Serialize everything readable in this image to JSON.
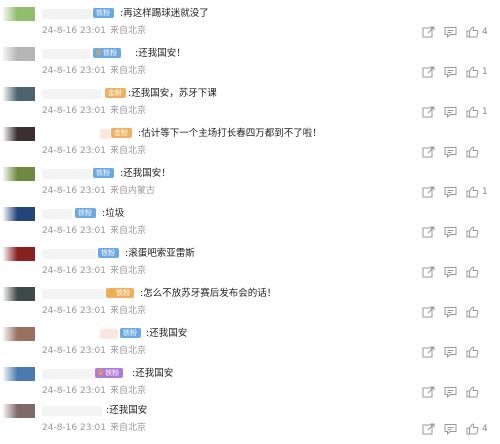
{
  "comments": [
    {
      "text": ":再这样踢球迷就没了",
      "badge": "铁粉",
      "badge_color": "#6aa8e8",
      "crown": false,
      "time": "24-8-16 23:01",
      "location": "来自北京",
      "likes": "4",
      "avatar_color": "#8fbf6a"
    },
    {
      "text": ":还我国安！",
      "badge": "铁粉",
      "badge_color": "#6aa8e8",
      "crown": true,
      "time": "24-8-16 23:01",
      "location": "来自北京",
      "likes": "1",
      "avatar_color": "#b5b5b5"
    },
    {
      "text": ":还我国安，苏牙下课",
      "badge": "金粉",
      "badge_color": "#f0b060",
      "crown": false,
      "time": "24-8-16 23:01",
      "location": "来自北京",
      "likes": "1",
      "avatar_color": "#4d6470"
    },
    {
      "text": ":估计等下一个主场打长春四万都到不了啦！",
      "badge": "金粉",
      "badge_color": "#f0b060",
      "crown": false,
      "time": "24-8-16 23:01",
      "location": "来自北京",
      "likes": "",
      "avatar_color": "#3a3030"
    },
    {
      "text": ":还我国安！",
      "badge": "铁粉",
      "badge_color": "#6aa8e8",
      "crown": false,
      "time": "24-8-16 23:01",
      "location": "来自内蒙古",
      "likes": "1",
      "avatar_color": "#6e8a40"
    },
    {
      "text": ":垃圾",
      "badge": "铁粉",
      "badge_color": "#6aa8e8",
      "crown": false,
      "time": "24-8-16 23:01",
      "location": "来自北京",
      "likes": "",
      "avatar_color": "#23457a"
    },
    {
      "text": ":滚蛋吧索亚雷斯",
      "badge": "铁粉",
      "badge_color": "#6aa8e8",
      "crown": false,
      "time": "24-8-16 23:01",
      "location": "来自北京",
      "likes": "",
      "avatar_color": "#8a2020"
    },
    {
      "text": ":怎么不放苏牙赛后发布会的话！",
      "badge": "铁粉",
      "badge_color": "#f0b060",
      "crown": true,
      "time": "24-8-16 23:01",
      "location": "来自北京",
      "likes": "",
      "avatar_color": "#3d4a48"
    },
    {
      "text": ":还我国安",
      "badge": "铁粉",
      "badge_color": "#6aa8e8",
      "crown": false,
      "time": "24-8-16 23:01",
      "location": "来自北京",
      "likes": "",
      "avatar_color": "#9a7060"
    },
    {
      "text": ":还我国安",
      "badge": "铁粉",
      "badge_color": "#b07ad8",
      "crown": true,
      "time": "24-8-16 23:01",
      "location": "来自北京",
      "likes": "",
      "avatar_color": "#4a7ab0"
    },
    {
      "text": ":还我国安",
      "badge": "",
      "badge_color": "",
      "crown": false,
      "time": "24-8-16 23:01",
      "location": "来自北京",
      "likes": "4",
      "avatar_color": "#806a68"
    }
  ],
  "icons": {
    "share": "share-icon",
    "comment": "comment-icon",
    "like": "thumbs-up-icon"
  }
}
